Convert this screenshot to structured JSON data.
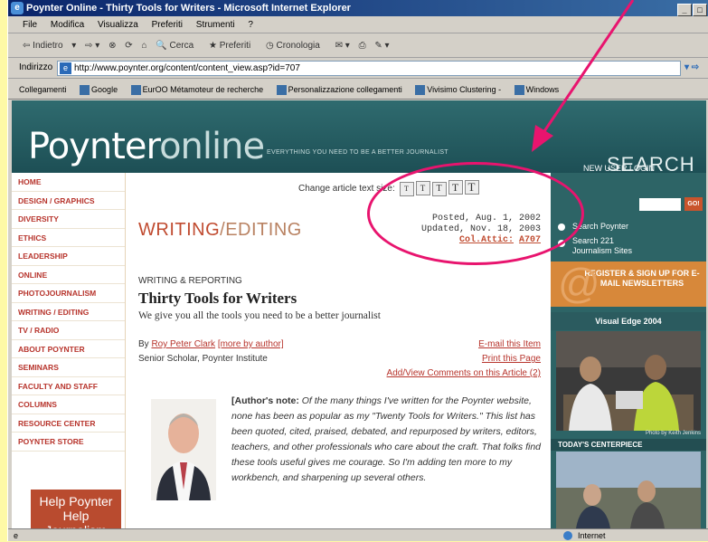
{
  "window": {
    "title": "Poynter Online - Thirty Tools for Writers - Microsoft Internet Explorer"
  },
  "menu": [
    "File",
    "Modifica",
    "Visualizza",
    "Preferiti",
    "Strumenti",
    "?"
  ],
  "toolbar": {
    "back": "Indietro",
    "search": "Cerca",
    "favorites": "Preferiti",
    "history": "Cronologia"
  },
  "address": {
    "label": "Indirizzo",
    "url": "http://www.poynter.org/content/content_view.asp?id=707",
    "go": "Vai"
  },
  "links": {
    "label": "Collegamenti",
    "items": [
      "Google",
      "EurOO Métamoteur de recherche",
      "Personalizzazione collegamenti",
      "Vivisimo Clustering -",
      "Windows"
    ]
  },
  "site": {
    "logo_a": "Poynter",
    "logo_b": "online",
    "tagline": "EVERYTHING YOU NEED TO BE A BETTER JOURNALIST",
    "toplinks": "NEW USER   LOGIN",
    "search_word": "SEARCH",
    "go": "GO!"
  },
  "nav": [
    "HOME",
    "DESIGN / GRAPHICS",
    "DIVERSITY",
    "ETHICS",
    "LEADERSHIP",
    "ONLINE",
    "PHOTOJOURNALISM",
    "WRITING / EDITING",
    "TV / RADIO",
    "ABOUT POYNTER",
    "SEMINARS",
    "FACULTY AND STAFF",
    "COLUMNS",
    "RESOURCE CENTER",
    "POYNTER STORE"
  ],
  "help": {
    "line1": "Help Poynter",
    "line2": "Help Journalism"
  },
  "article": {
    "size_label": "Change article text size:",
    "sizes": [
      "T",
      "T",
      "T",
      "T",
      "T"
    ],
    "section_a": "WRITING",
    "section_slash": "/",
    "section_b": "EDITING",
    "posted": "Posted, Aug. 1, 2002",
    "updated": "Updated, Nov. 18, 2003",
    "column_label": "Col.Attic:",
    "column_num": "A707",
    "kicker": "WRITING & REPORTING",
    "headline": "Thirty Tools for Writers",
    "deck": "We give you all the tools you need to be a better journalist",
    "by": "By",
    "author": "Roy Peter Clark",
    "more": "[more by author]",
    "role": "Senior Scholar, Poynter Institute",
    "email": "E-mail this Item",
    "print": "Print this Page",
    "comments": "Add/View Comments on this Article (2)",
    "note_label": "[Author's note:",
    "note": " Of the many things I've written for the Poynter website, none has been as popular as my \"Twenty Tools for Writers.\" This list has been quoted, cited, praised, debated, and repurposed by writers, editors, teachers, and other professionals who care about the craft. That folks find these tools useful gives me courage. So I'm adding ten more to my workbench, and sharpening up several others."
  },
  "right": {
    "opt1": "Search Poynter",
    "opt2a": "Search 221",
    "opt2b": "Journalism Sites",
    "register": "REGISTER & SIGN UP FOR E-MAIL NEWSLETTERS",
    "ve_head": "Visual Edge 2004",
    "credit": "Photo by Keith Jenkins",
    "centerpiece": "TODAY'S CENTERPIECE"
  },
  "status": {
    "zone": "Internet"
  },
  "colors": {
    "accent": "#e8146e",
    "nav_red": "#b7342c",
    "teal": "#2d6466"
  }
}
